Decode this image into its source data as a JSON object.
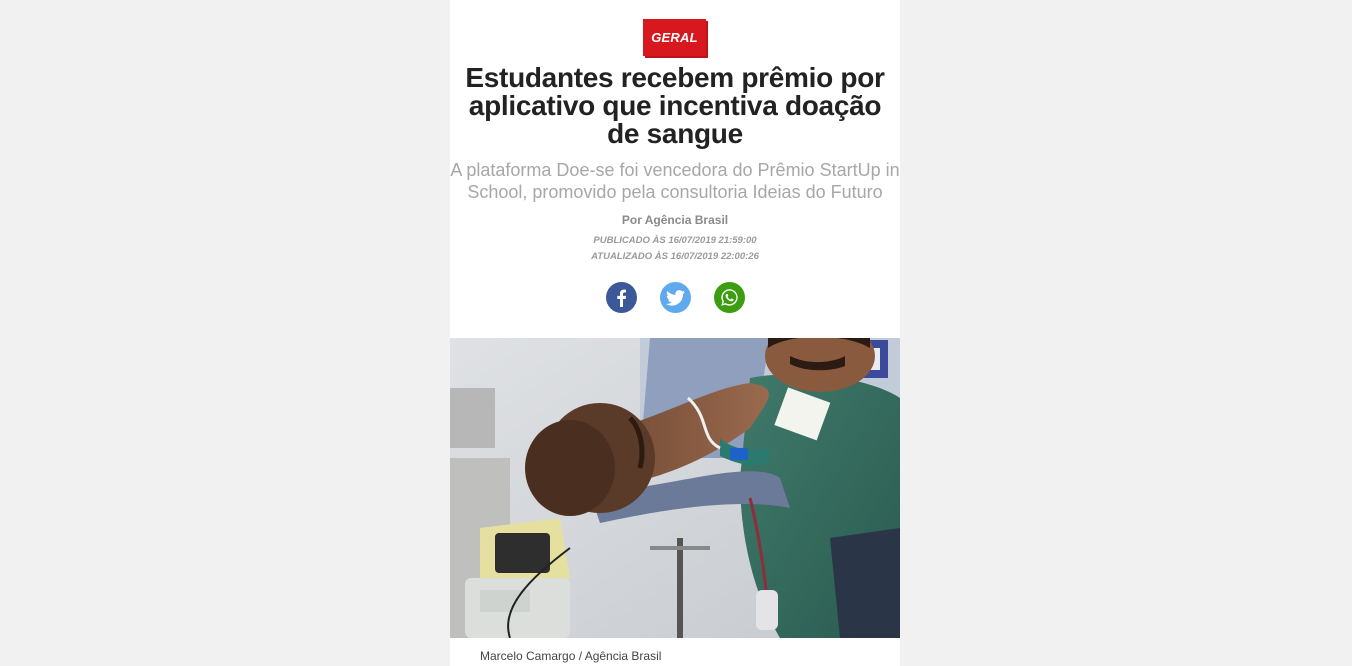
{
  "article": {
    "category": "GERAL",
    "headline": "Estudantes recebem prêmio por aplicativo que incentiva doação de sangue",
    "subtitle": "A plataforma Doe-se foi vencedora do Prêmio StartUp in School, promovido pela consultoria Ideias do Futuro",
    "author": "Por Agência Brasil",
    "published": "PUBLICADO ÀS 16/07/2019 21:59:00",
    "updated": "ATUALIZADO ÀS 16/07/2019 22:00:26",
    "photo_credit": "Marcelo Camargo / Agência Brasil"
  },
  "share": [
    {
      "network": "facebook",
      "icon": "facebook-icon",
      "color": "#3b5998"
    },
    {
      "network": "twitter",
      "icon": "twitter-icon",
      "color": "#5fa9ee"
    },
    {
      "network": "whatsapp",
      "icon": "whatsapp-icon",
      "color": "#3c9d10"
    }
  ],
  "colors": {
    "accent": "#d7191f",
    "page_background": "#f1f1f1"
  }
}
